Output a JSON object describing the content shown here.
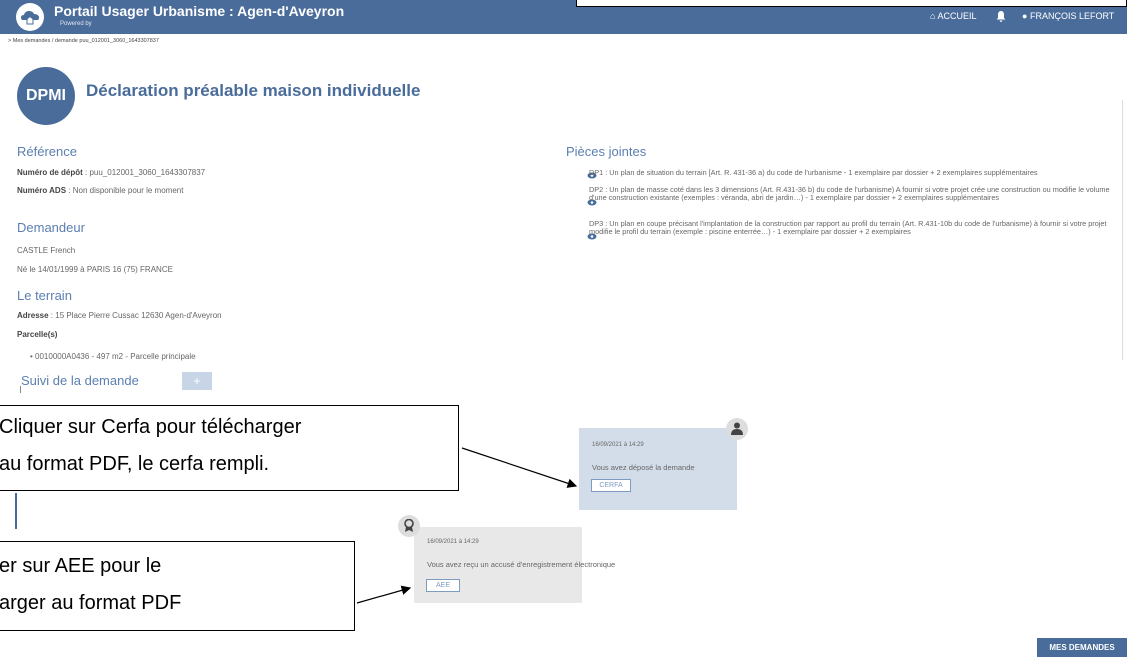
{
  "header": {
    "title": "Portail Usager Urbanisme : Agen-d'Aveyron",
    "powered": "Powered by ",
    "nav_home": "ACCUEIL",
    "nav_user": "FRANÇOIS LEFORT"
  },
  "breadcrumb": ">  Mes demandes / demande puu_012001_3060_1643307837",
  "dossier": {
    "badge": "DPMI",
    "title": "Déclaration préalable maison individuelle"
  },
  "reference": {
    "heading": "Référence",
    "depot_label": "Numéro de dépôt",
    "depot_value": " : puu_012001_3060_1643307837",
    "ads_label": "Numéro ADS",
    "ads_value": " : Non disponible pour le moment"
  },
  "demandeur": {
    "heading": "Demandeur",
    "name": "CASTLE French",
    "birth": "Né le 14/01/1999 à PARIS 16 (75) FRANCE"
  },
  "terrain": {
    "heading": "Le terrain",
    "adresse_label": "Adresse",
    "adresse_value": " : 15 Place Pierre Cussac 12630 Agen-d'Aveyron",
    "parcelles_label": "Parcelle(s)",
    "parcelle_1": "0010000A0436 - 497 m2 - Parcelle principale"
  },
  "suivi": {
    "heading": "Suivi de la demande",
    "plus": "+"
  },
  "pieces": {
    "heading": "Pièces jointes",
    "items": [
      "DP1 : Un plan de situation du terrain [Art. R. 431-36 a) du code de l'urbanisme - 1 exemplaire par dossier + 2 exemplaires supplémentaires",
      "DP2 : Un plan de masse coté dans les 3 dimensions (Art. R.431-36 b) du code de l'urbanisme) A fournir si votre projet crée une construction ou modifie le volume d'une construction existante (exemples : véranda, abri de jardin…) - 1 exemplaire par dossier + 2 exemplaires supplémentaires",
      "DP3 : Un plan en coupe précisant l'implantation de la construction par rapport au profil du terrain (Art. R.431-10b du code de l'urbanisme) à fournir si votre projet modifie le profil du terrain (exemple : piscine enterrée…) - 1 exemplaire par dossier + 2 exemplaires"
    ]
  },
  "timeline": {
    "card1": {
      "date": "16/09/2021 à 14:29",
      "text": "Vous avez déposé la demande",
      "button": "CERFA"
    },
    "card2": {
      "date": "16/09/2021 à 14:29",
      "text": "Vous avez reçu un accusé d'enregistrement électronique",
      "button": "AEE"
    }
  },
  "callouts": {
    "cerfa_line1": "Cliquer sur Cerfa  pour télécharger",
    "cerfa_line2": "au format PDF, le cerfa rempli.",
    "aee_line1": "er sur AEE  pour le",
    "aee_line2": "arger au format PDF"
  },
  "footer": {
    "mes_demandes": "MES DEMANDES"
  },
  "colors": {
    "primary": "#4a6c9b",
    "heading": "#5b7fb0",
    "card_blue": "#d2dde9",
    "card_grey": "#e8e8e8"
  }
}
